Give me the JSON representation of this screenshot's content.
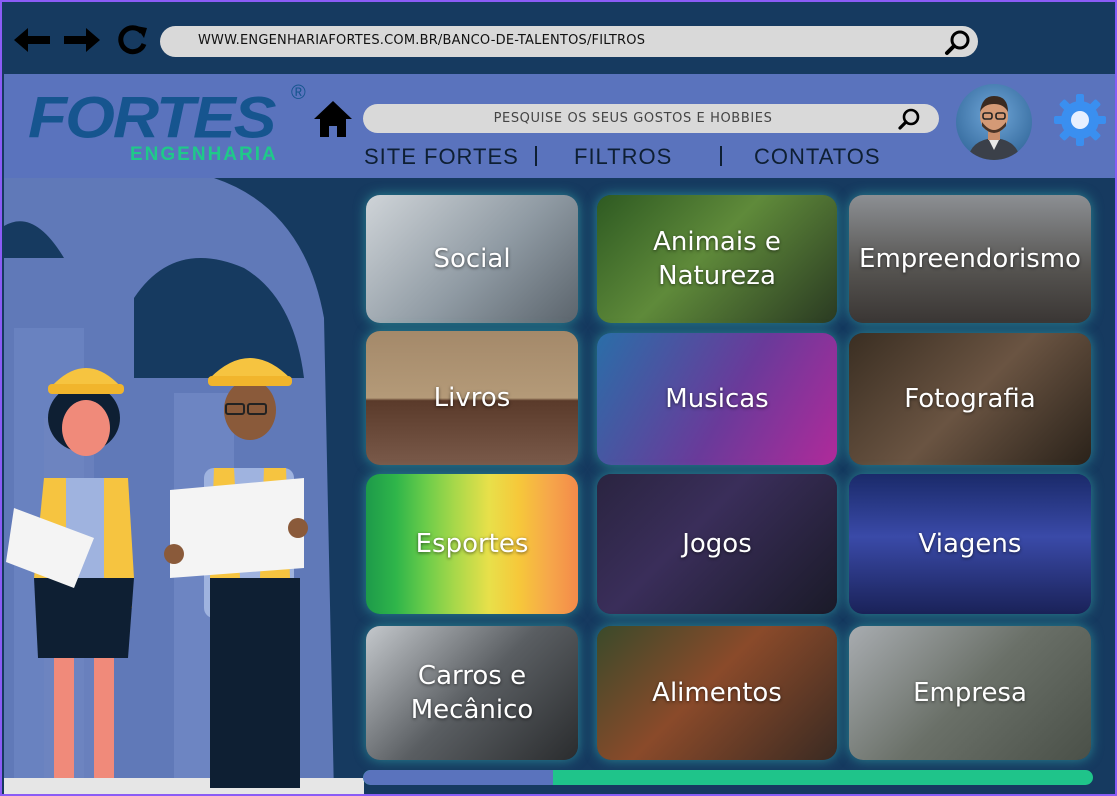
{
  "browser": {
    "back_icon": "arrow-left-icon",
    "forward_icon": "arrow-right-icon",
    "reload_icon": "reload-icon",
    "url": "WWW.ENGENHARIAFORTES.COM.BR/BANCO-DE-TALENTOS/FILTROS",
    "search_icon": "search-icon"
  },
  "header": {
    "logo_text": "FORTES",
    "logo_reg": "®",
    "logo_sub": "ENGENHARIA",
    "home_icon": "home-icon",
    "search_placeholder": "PESQUISE OS SEUS GOSTOS E HOBBIES",
    "menu": [
      {
        "label": "SITE FORTES"
      },
      {
        "label": "FILTROS"
      },
      {
        "label": "CONTATOS"
      }
    ],
    "settings_icon": "gear-icon"
  },
  "categories": [
    {
      "label": "Social"
    },
    {
      "label": "Animais e Natureza"
    },
    {
      "label": "Empreendorismo"
    },
    {
      "label": "Livros"
    },
    {
      "label": "Musicas"
    },
    {
      "label": "Fotografia"
    },
    {
      "label": "Esportes"
    },
    {
      "label": "Jogos"
    },
    {
      "label": "Viagens"
    },
    {
      "label": "Carros e Mecânico"
    },
    {
      "label": "Alimentos"
    },
    {
      "label": "Empresa"
    }
  ],
  "scroll": {
    "progress": 0.26
  },
  "colors": {
    "background": "#163a60",
    "header": "#5a73bd",
    "logo_blue": "#16558f",
    "logo_green": "#1fc98a",
    "progress_track": "#1fc48a",
    "accent_gear": "#3a8ff0"
  }
}
